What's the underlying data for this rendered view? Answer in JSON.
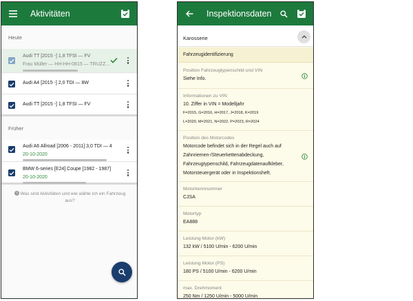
{
  "left_screen": {
    "title": "Aktivitäten",
    "section_today": "Heute",
    "section_earlier": "Früher",
    "today_items": [
      {
        "title": "Audi TT [2015 -] 1,8 TFSI — FV",
        "subtitle": "Frau Müller — HH-HH-0815 — TRUZZ..."
      },
      {
        "title": "Audi A4 [2015 -] 2,0 TDI — 8W"
      },
      {
        "title": "Audi TT [2015 -] 1,8 TFSI — FV"
      }
    ],
    "earlier_items": [
      {
        "title": "Audi A6 Allroad [2006 - 2011] 3,0 TDI — 4",
        "date": "20-10-2020"
      },
      {
        "title": "BMW 6-series [E24] Coupe [1982 - 1987]",
        "date": "20-10-2020"
      }
    ],
    "help_line1": "Was sind Aktivitäten und wie wähle ich ein Fahrzeug",
    "help_line2": "aus?"
  },
  "right_screen": {
    "title": "Inspektionsdaten",
    "section_title": "Karosserie",
    "group_title": "Fahrzeugidentifizierung",
    "fields": {
      "vin_plate_label": "Position Fahrzeugtypenschild und VIN",
      "vin_plate_value": "Siehe Info.",
      "vin_info_label": "Informationen zu VIN",
      "vin_info_value": "10. Ziffer in VIN = Modelljahr",
      "vin_info_line2": "F=2015, G=2016, H=2017, J=2018, K=2019",
      "vin_info_line3": "L=2020, M=2021, N=2022, P=2023, R=2024",
      "motor_pos_label": "Position des Motorcodes",
      "motor_pos_line1": "Motorcode befindet sich in der Regel auch auf",
      "motor_pos_line2": "Zahnriemen-/Steuerkettenabdeckung,",
      "motor_pos_line3": "Fahrzeugtypenschild, Fahrzeugdatenaufkleber,",
      "motor_pos_line4": "Motorsteuergerät oder in Inspektionsheft.",
      "motor_num_label": "Motorkennnummer",
      "motor_num_value": "CJSA",
      "motor_type_label": "Motortyp",
      "motor_type_value": "EA888",
      "power_kw_label": "Leistung Motor (kW)",
      "power_kw_value": "132 kW / 5100 U/min - 6200 U/min",
      "power_ps_label": "Leistung Motor (PS)",
      "power_ps_value": "180 PS / 5100 U/min - 6200 U/min",
      "torque_label": "max. Drehmoment",
      "torque_value": "250 Nm / 1250 U/min - 5000 U/min"
    }
  },
  "colors": {
    "app_bar": "#1d7a3d",
    "checkbox": "#1a3d6d",
    "date_green": "#2e8b3a",
    "field_background": "#fdfbe9",
    "info_icon": "#2e8b3a"
  },
  "icons": {
    "menu": "menu-icon",
    "checklist": "checklist-icon",
    "back": "back-arrow-icon",
    "search": "search-icon",
    "collapse": "chevron-up-icon",
    "info": "info-icon",
    "overflow": "more-vert-icon",
    "help": "help-icon",
    "check": "check-icon"
  }
}
